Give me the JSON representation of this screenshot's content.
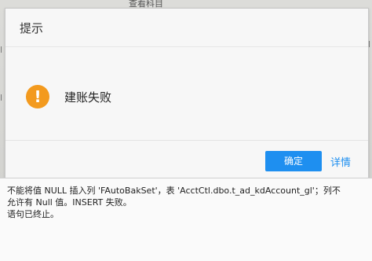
{
  "background": {
    "tab_label": "查看科目",
    "fragments": [
      "l",
      "l",
      "ll",
      "/",
      "/"
    ]
  },
  "dialog": {
    "title": "提示",
    "icon": "warning-icon",
    "message": "建账失败",
    "ok_label": "确定",
    "details_label": "详情"
  },
  "error_details": {
    "lines": [
      "不能将值 NULL 插入列 'FAutoBakSet'，表 'AcctCtl.dbo.t_ad_kdAccount_gl'；列不",
      "允许有 Null 值。INSERT 失败。",
      "语句已终止。"
    ]
  },
  "colors": {
    "accent": "#1e8ff0",
    "warning": "#f39a1e"
  }
}
